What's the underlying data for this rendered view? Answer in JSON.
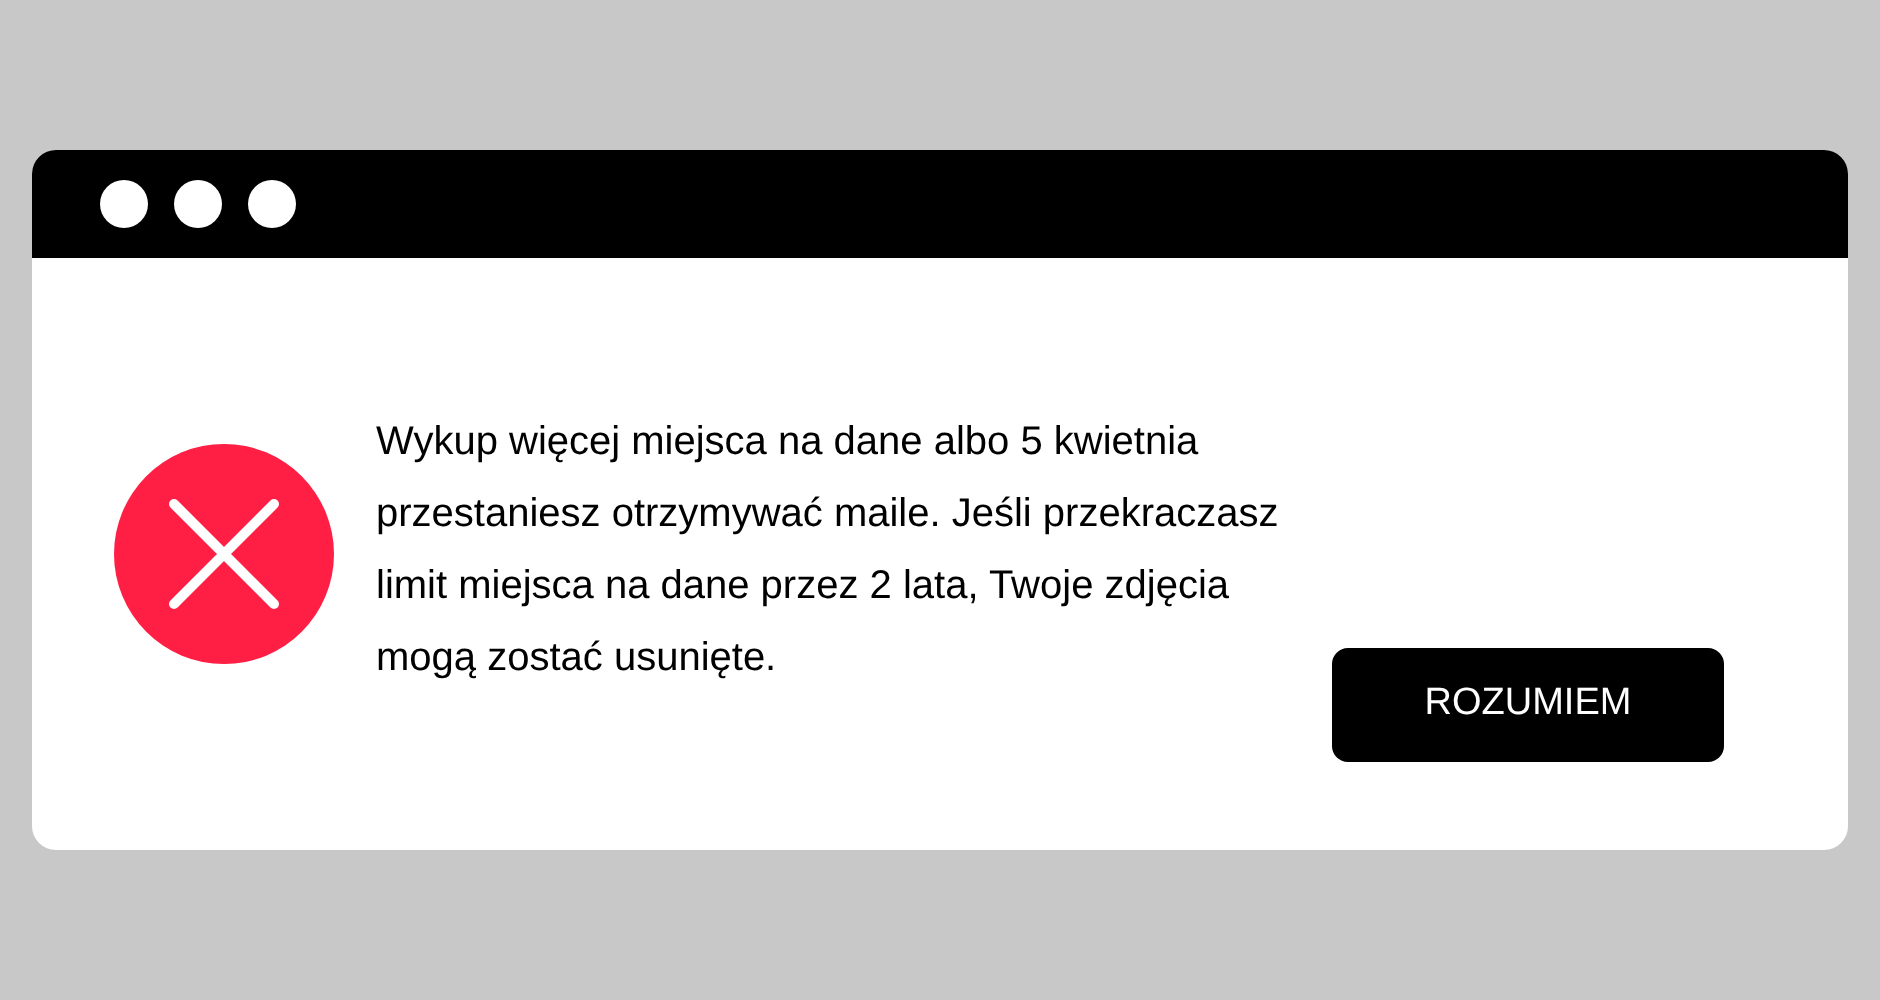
{
  "dialog": {
    "kind": "error",
    "message": "Wykup więcej miejsca na dane albo 5 kwietnia przestaniesz otrzymywać maile. Jeśli przekraczasz limit miejsca na dane przez 2 lata, Twoje zdjęcia mogą zostać usunięte.",
    "button": "ROZUMIEM"
  }
}
